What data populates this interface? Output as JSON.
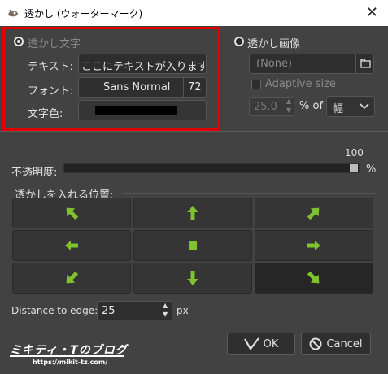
{
  "window": {
    "title": "透かし (ウォーターマーク)"
  },
  "text_mode": {
    "radio_label": "透かし文字",
    "text_label": "テキスト:",
    "text_value": "ここにテキストが入ります",
    "font_label": "フォント:",
    "font_name": "Sans Normal",
    "font_size": "72",
    "color_label": "文字色:",
    "color_value": "#000000"
  },
  "image_mode": {
    "radio_label": "透かし画像",
    "file_value": "(None)",
    "adaptive_label": "Adaptive size",
    "size_value": "25.0",
    "percent_label": "% of",
    "dimension_value": "幅"
  },
  "opacity": {
    "label": "不透明度:",
    "value": "100",
    "unit": "%",
    "level": 1.0
  },
  "position": {
    "label": "透かしを入れる位置:",
    "buttons": [
      "top-left",
      "top",
      "top-right",
      "left",
      "center",
      "right",
      "bottom-left",
      "bottom",
      "bottom-right"
    ],
    "selected": "bottom-right"
  },
  "edge": {
    "label": "Distance to edge:",
    "value": "25",
    "unit": "px"
  },
  "buttons": {
    "ok": "OK",
    "cancel": "Cancel"
  },
  "watermark": {
    "logo": "ミキティ・Tのブログ",
    "url": "https://mikit-tz.com/"
  },
  "colors": {
    "accent": "#7fc22d",
    "highlight": "#e00000",
    "background": "#424242"
  }
}
